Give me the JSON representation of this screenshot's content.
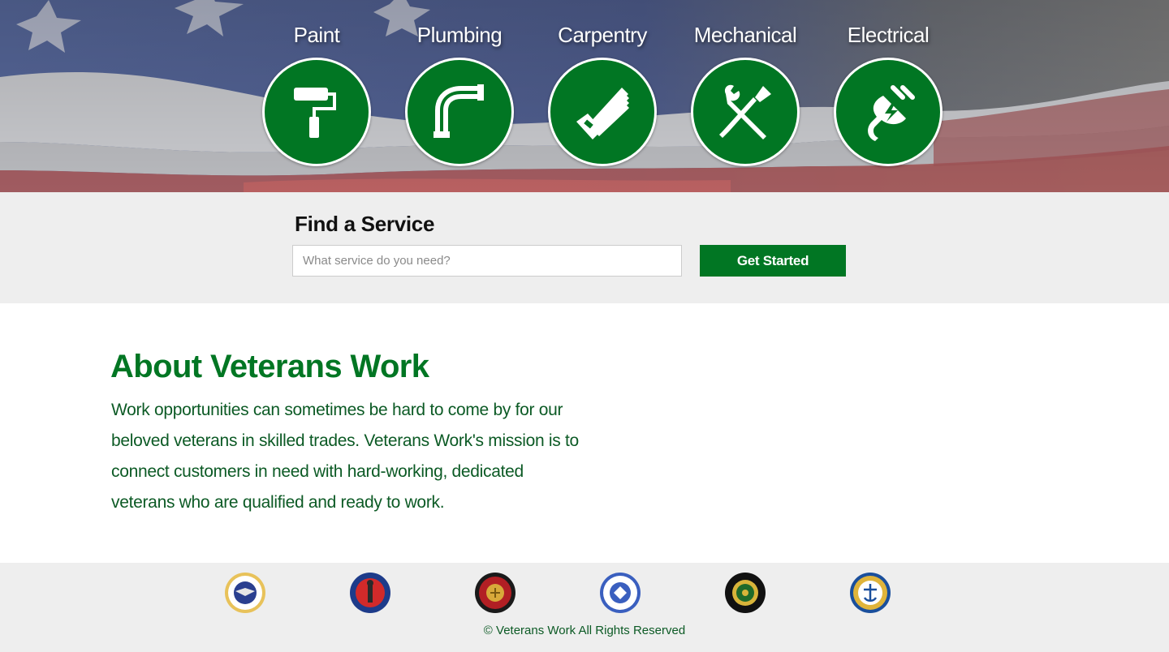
{
  "hero": {
    "services": [
      {
        "label": "Paint",
        "icon": "paint-roller-icon"
      },
      {
        "label": "Plumbing",
        "icon": "pipe-elbow-icon"
      },
      {
        "label": "Carpentry",
        "icon": "saw-icon"
      },
      {
        "label": "Mechanical",
        "icon": "wrench-screwdriver-icon"
      },
      {
        "label": "Electrical",
        "icon": "electric-plug-icon"
      }
    ],
    "accent_color": "#017623"
  },
  "search": {
    "title": "Find a Service",
    "placeholder": "What service do you need?",
    "button_label": "Get Started"
  },
  "about": {
    "title": "About Veterans Work",
    "text": "Work opportunities can sometimes be hard to come by for our beloved veterans in skilled trades. Veterans Work's mission is to connect customers in need with hard-working, dedicated veterans who are qualified and ready to work."
  },
  "footer": {
    "seals": [
      {
        "icon": "air-force-seal-icon"
      },
      {
        "icon": "national-guard-seal-icon"
      },
      {
        "icon": "marine-corps-seal-icon"
      },
      {
        "icon": "navy-seal-icon"
      },
      {
        "icon": "army-seal-icon"
      },
      {
        "icon": "coast-guard-seal-icon"
      }
    ],
    "copyright": "© Veterans Work All Rights Reserved"
  }
}
